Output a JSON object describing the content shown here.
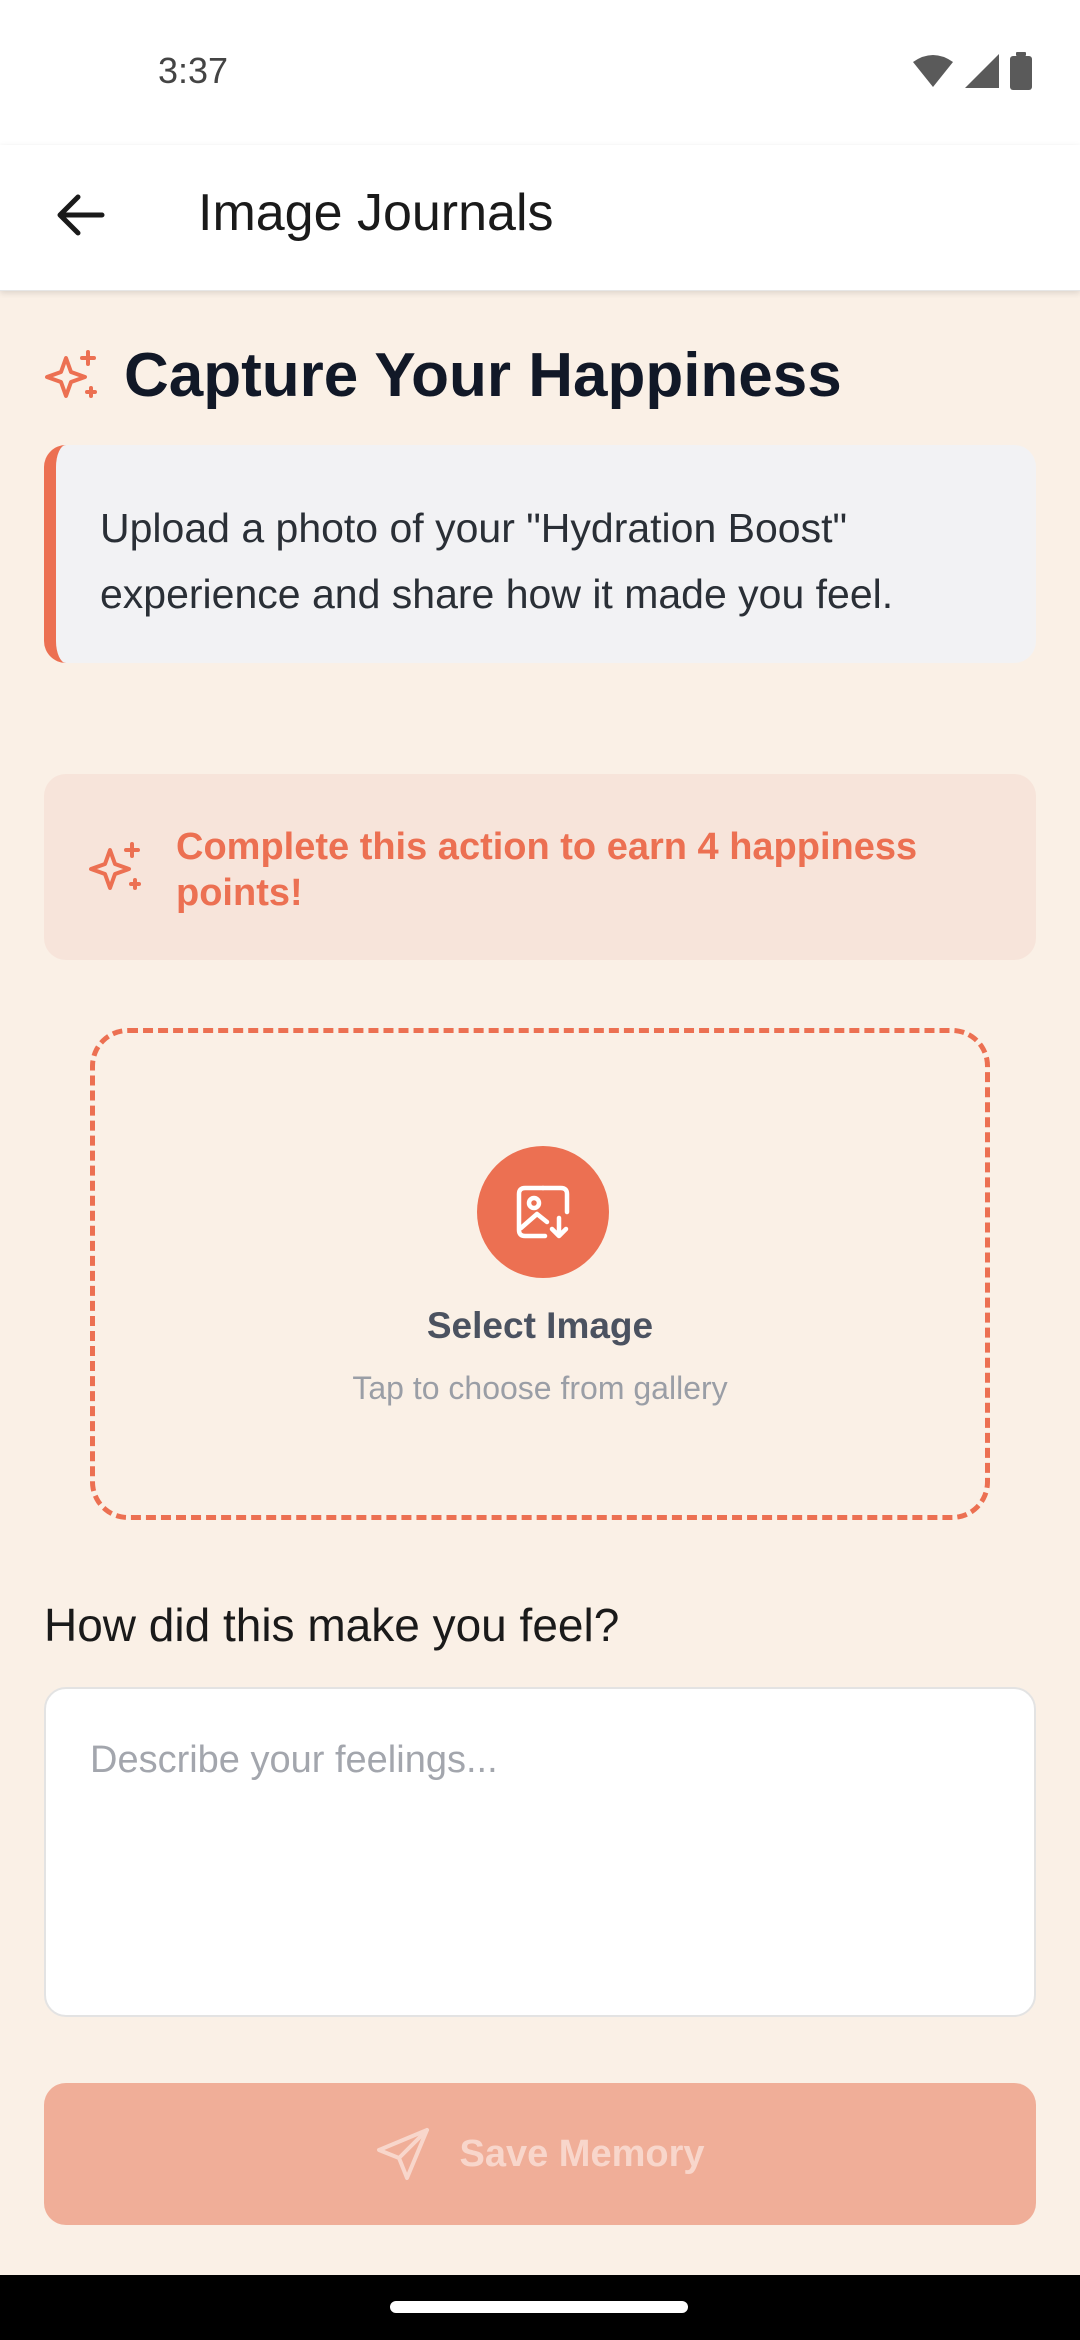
{
  "status_bar": {
    "time": "3:37",
    "icons": [
      "wifi-icon",
      "signal-icon",
      "battery-icon"
    ]
  },
  "app_bar": {
    "title": "Image Journals",
    "back_icon": "arrow-left-icon"
  },
  "main": {
    "title": "Capture Your Happiness",
    "title_icon": "sparkles-icon",
    "info_text": "Upload a photo of your \"Hydration Boost\" experience and share how it made you feel.",
    "points_text": "Complete this action to earn 4 happiness points!",
    "points_icon": "sparkles-icon",
    "upload": {
      "icon": "image-download-icon",
      "title": "Select Image",
      "subtitle": "Tap to choose from gallery"
    },
    "feel_label": "How did this make you feel?",
    "feel_input": {
      "value": "",
      "placeholder": "Describe your feelings..."
    },
    "save_button": {
      "label": "Save Memory",
      "icon": "send-icon",
      "state": "disabled"
    }
  },
  "colors": {
    "background": "#FAF0E6",
    "accent": "#EC7052",
    "accent_disabled": "#F0AE98",
    "points_bg": "#F7E4DA",
    "info_bg": "#F2F2F4",
    "title_text": "#111827"
  }
}
